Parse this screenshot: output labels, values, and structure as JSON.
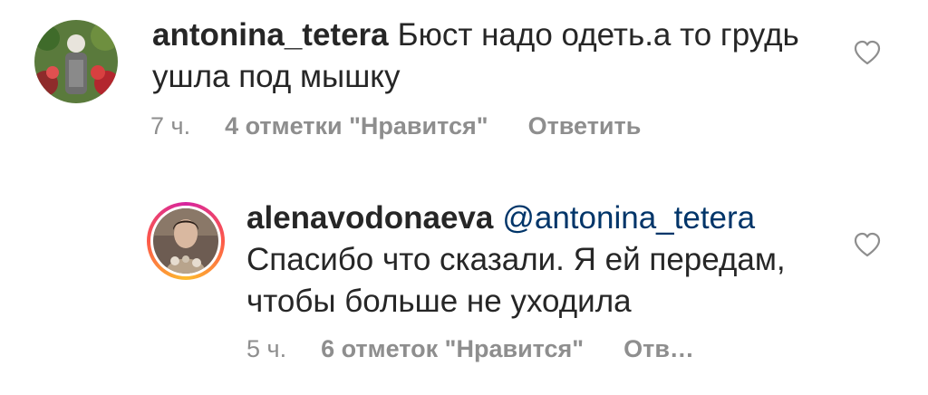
{
  "comments": [
    {
      "username": "antonina_tetera",
      "text": "Бюст надо одеть.а то грудь ушла под мышку",
      "time": "7 ч.",
      "likes": "4 отметки \"Нравится\"",
      "reply": "Ответить",
      "icons": {
        "like": "heart-outline-icon"
      }
    },
    {
      "username": "alenavodonaeva",
      "mention": "@antonina_tetera",
      "text": "Спасибо что сказали. Я ей передам, чтобы больше не уходила",
      "time": "5 ч.",
      "likes": "6 отметок \"Нравится\"",
      "reply": "Отв…",
      "icons": {
        "like": "heart-outline-icon"
      }
    }
  ],
  "colors": {
    "text": "#262626",
    "meta": "#8e8e8e",
    "mention": "#003569"
  }
}
